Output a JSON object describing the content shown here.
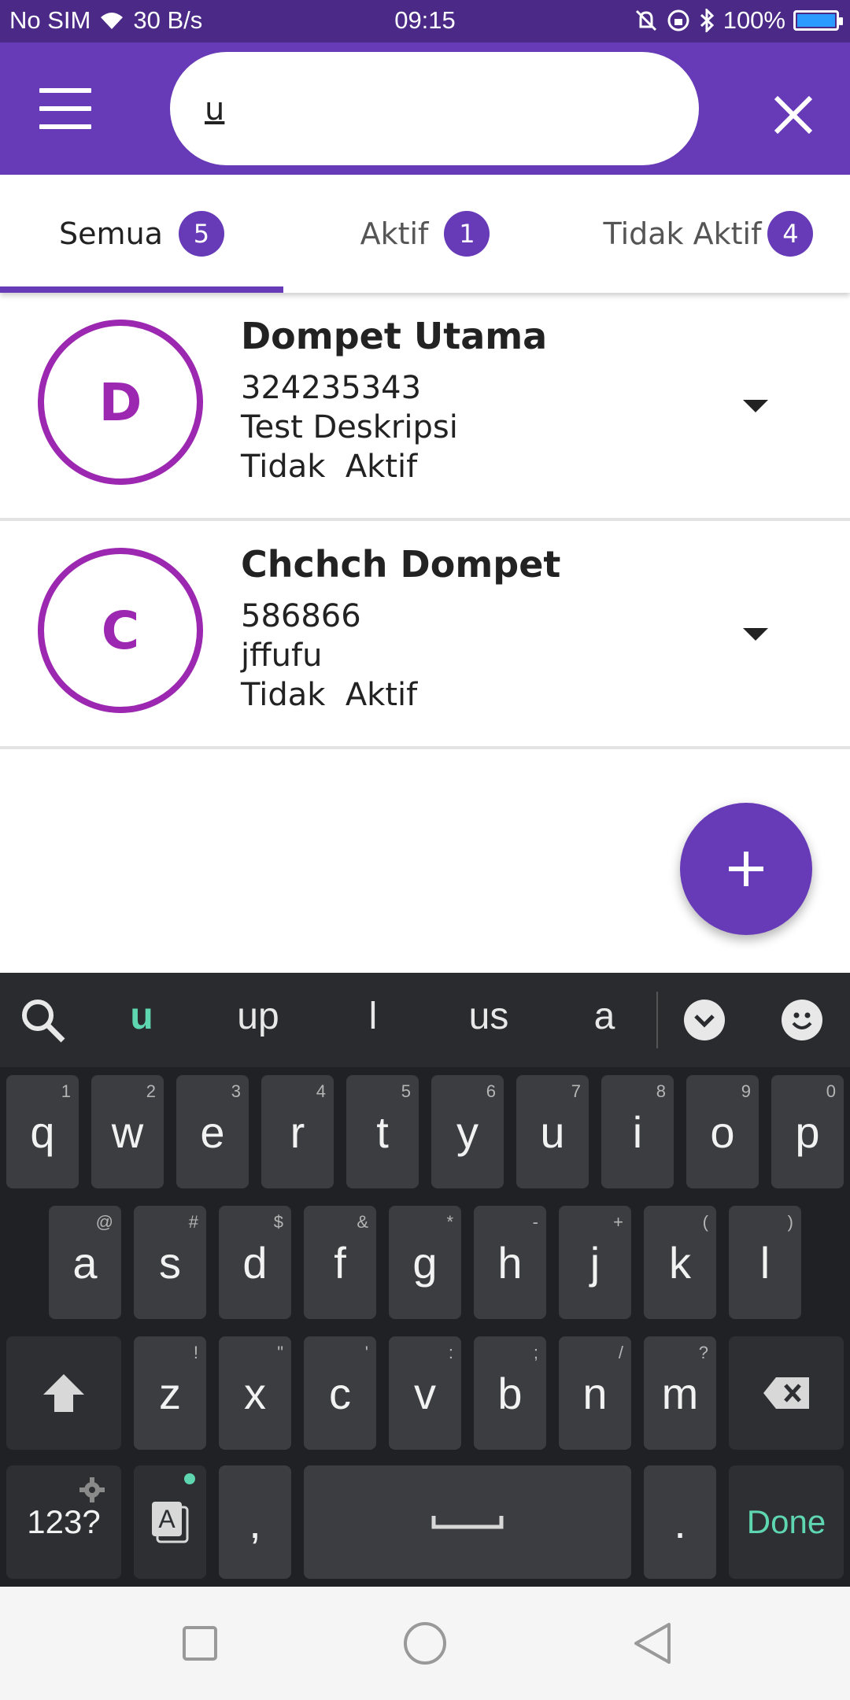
{
  "status_bar": {
    "carrier": "No SIM",
    "speed": "30 B/s",
    "time": "09:15",
    "battery": "100%",
    "battery_level": 1.0
  },
  "toolbar": {
    "search_value": "u"
  },
  "tabs": [
    {
      "label": "Semua",
      "count": "5",
      "active": true
    },
    {
      "label": "Aktif",
      "count": "1",
      "active": false
    },
    {
      "label": "Tidak Aktif",
      "count": "4",
      "active": false
    }
  ],
  "wallets": [
    {
      "initial": "D",
      "name": "Dompet Utama",
      "number": "324235343",
      "description": "Test Deskripsi",
      "status": "Tidak  Aktif"
    },
    {
      "initial": "C",
      "name": "Chchch Dompet",
      "number": "586866",
      "description": "jffufu",
      "status": "Tidak  Aktif"
    }
  ],
  "keyboard": {
    "suggestions": [
      "u",
      "up",
      "l",
      "us",
      "a"
    ],
    "row1": [
      {
        "key": "q",
        "hint": "1"
      },
      {
        "key": "w",
        "hint": "2"
      },
      {
        "key": "e",
        "hint": "3"
      },
      {
        "key": "r",
        "hint": "4"
      },
      {
        "key": "t",
        "hint": "5"
      },
      {
        "key": "y",
        "hint": "6"
      },
      {
        "key": "u",
        "hint": "7"
      },
      {
        "key": "i",
        "hint": "8"
      },
      {
        "key": "o",
        "hint": "9"
      },
      {
        "key": "p",
        "hint": "0"
      }
    ],
    "row2": [
      {
        "key": "a",
        "hint": "@"
      },
      {
        "key": "s",
        "hint": "#"
      },
      {
        "key": "d",
        "hint": "$"
      },
      {
        "key": "f",
        "hint": "&"
      },
      {
        "key": "g",
        "hint": "*"
      },
      {
        "key": "h",
        "hint": "-"
      },
      {
        "key": "j",
        "hint": "+"
      },
      {
        "key": "k",
        "hint": "("
      },
      {
        "key": "l",
        "hint": ")"
      }
    ],
    "row3": [
      {
        "key": "z",
        "hint": "!"
      },
      {
        "key": "x",
        "hint": "\""
      },
      {
        "key": "c",
        "hint": "'"
      },
      {
        "key": "v",
        "hint": ":"
      },
      {
        "key": "b",
        "hint": ";"
      },
      {
        "key": "n",
        "hint": "/"
      },
      {
        "key": "m",
        "hint": "?"
      }
    ],
    "numbers_label": "123?",
    "comma": ",",
    "period": ".",
    "done_label": "Done"
  },
  "colors": {
    "primary": "#673ab7",
    "status_bar": "#4a2a86",
    "avatar_ring": "#9c27b0",
    "keyboard_accent": "#5ed6b0"
  },
  "icons": {
    "menu": "menu-icon",
    "clear": "close-icon",
    "expand": "chevron-down-icon",
    "add": "plus-icon"
  }
}
